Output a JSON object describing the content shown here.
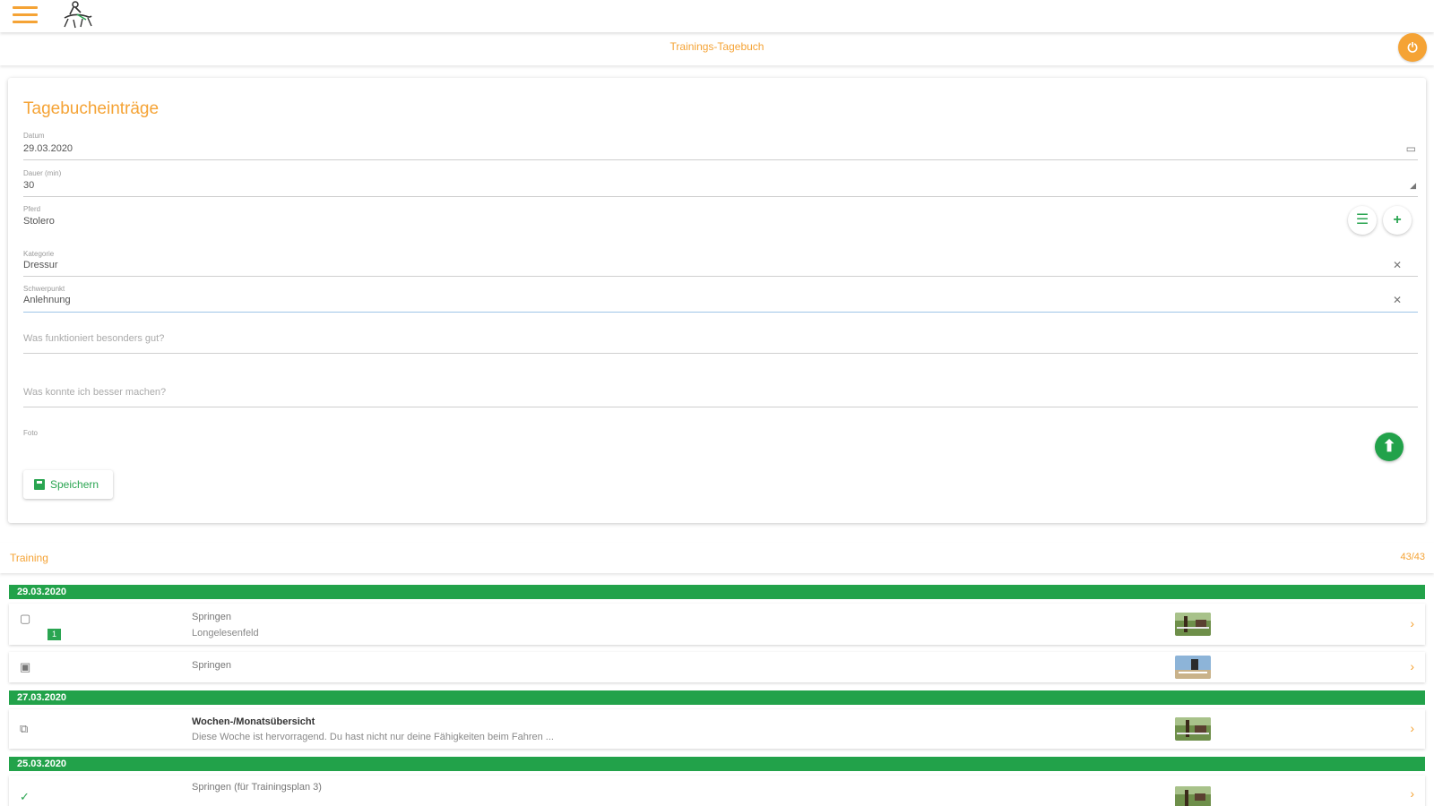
{
  "header": {
    "page_title": "Trainings-Tagebuch",
    "menu_icon": "hamburger-menu-icon",
    "logo_icon": "rider-horse-logo-icon",
    "back_icon": "chevron-left-icon",
    "right_icon": "power-icon"
  },
  "form": {
    "title": "Tagebucheinträge",
    "datum": {
      "label": "Datum",
      "value": "29.03.2020"
    },
    "dauer": {
      "label": "Dauer (min)",
      "value": "30"
    },
    "pferd": {
      "label": "Pferd",
      "value": "Stolero"
    },
    "kategorie": {
      "label": "Kategorie",
      "value": "Dressur"
    },
    "schwerpunkt": {
      "label": "Schwerpunkt",
      "value": "Anlehnung"
    },
    "gut_placeholder": "Was funktioniert besonders gut?",
    "besser_placeholder": "Was konnte ich besser machen?",
    "foto_label": "Foto",
    "save_label": "Speichern"
  },
  "list_header": {
    "left": "Training",
    "right": "43/43"
  },
  "groups": [
    {
      "date": "29.03.2020",
      "entries": [
        {
          "line1": "Springen",
          "line2": "Longelesenfeld",
          "icon": "calendar-icon",
          "badge": "1"
        },
        {
          "line1": "Springen",
          "line2": "",
          "icon": "calendar-check-icon"
        }
      ]
    },
    {
      "date": "27.03.2020",
      "entries": [
        {
          "line1": "Wochen-/Monatsübersicht",
          "line2": "Diese Woche ist hervorragend. Du hast nicht nur deine Fähigkeiten beim Fahren ...",
          "icon": "gallery-icon"
        }
      ]
    },
    {
      "date": "25.03.2020",
      "entries": [
        {
          "line1": "Springen (für Trainingsplan 3)",
          "line2": "",
          "icon": "check-circle-icon"
        }
      ]
    }
  ],
  "colors": {
    "accent": "#f5a335",
    "green": "#22a24a"
  }
}
